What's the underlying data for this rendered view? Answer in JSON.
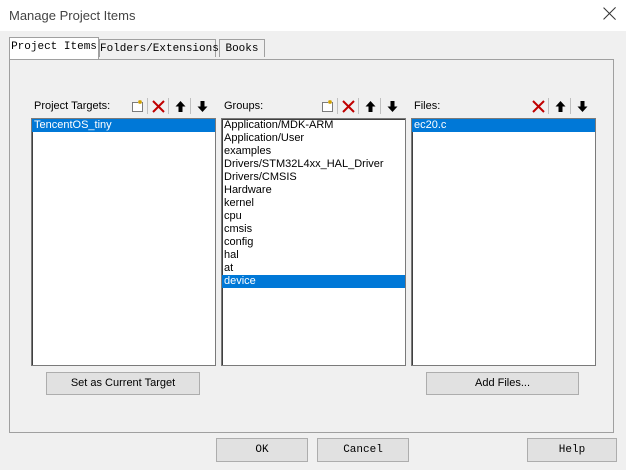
{
  "window": {
    "title": "Manage Project Items"
  },
  "tabs": [
    {
      "label": "Project Items",
      "active": true
    },
    {
      "label": "Folders/Extensions",
      "active": false
    },
    {
      "label": "Books",
      "active": false
    }
  ],
  "targets": {
    "label": "Project Targets:",
    "items": [
      "TencentOS_tiny"
    ],
    "selected": 0,
    "button": "Set as Current Target"
  },
  "groups": {
    "label": "Groups:",
    "items": [
      "Application/MDK-ARM",
      "Application/User",
      "examples",
      "Drivers/STM32L4xx_HAL_Driver",
      "Drivers/CMSIS",
      "Hardware",
      "kernel",
      "cpu",
      "cmsis",
      "config",
      "hal",
      "at",
      "device"
    ],
    "selected": 12
  },
  "files": {
    "label": "Files:",
    "items": [
      "ec20.c"
    ],
    "selected": 0,
    "button": "Add Files..."
  },
  "footer": {
    "ok": "OK",
    "cancel": "Cancel",
    "help": "Help"
  },
  "icons": [
    "new-icon",
    "delete-icon",
    "move-up-icon",
    "move-down-icon"
  ],
  "colors": {
    "selection": "#0078d7",
    "delete": "#c00000"
  }
}
